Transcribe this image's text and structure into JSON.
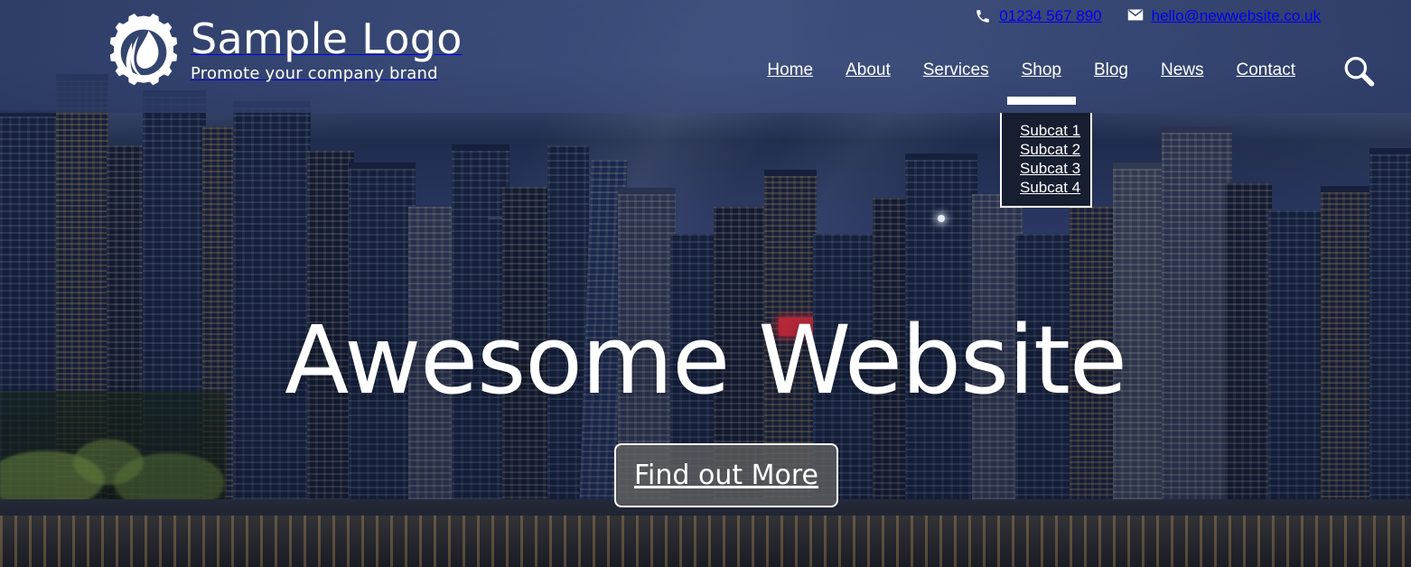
{
  "brand": {
    "logo_icon": "gear-droplet-logo-icon",
    "title": "Sample Logo",
    "tagline": "Promote your company brand"
  },
  "contact": {
    "phone_icon": "phone-icon",
    "phone": "01234 567 890",
    "email_icon": "envelope-icon",
    "email": "hello@newwebsite.co.uk"
  },
  "nav": {
    "items": [
      {
        "label": "Home",
        "active": false
      },
      {
        "label": "About",
        "active": false
      },
      {
        "label": "Services",
        "active": false
      },
      {
        "label": "Shop",
        "active": true
      },
      {
        "label": "Blog",
        "active": false
      },
      {
        "label": "News",
        "active": false
      },
      {
        "label": "Contact",
        "active": false
      }
    ],
    "search_icon": "search-icon"
  },
  "dropdown": {
    "parent": "Shop",
    "items": [
      {
        "label": "Subcat 1"
      },
      {
        "label": "Subcat 2"
      },
      {
        "label": "Subcat 3"
      },
      {
        "label": "Subcat 4"
      }
    ]
  },
  "hero": {
    "headline": "Awesome Website",
    "cta_label": "Find out More",
    "background": "city-skyline-at-dusk-photo"
  },
  "colors": {
    "header_overlay": "#344470",
    "dropdown_bg": "#161e30",
    "dropdown_border": "#ffffff",
    "cta_bg": "#616161",
    "text_on_dark": "#ffffff",
    "sky": "#4b5c8e"
  }
}
